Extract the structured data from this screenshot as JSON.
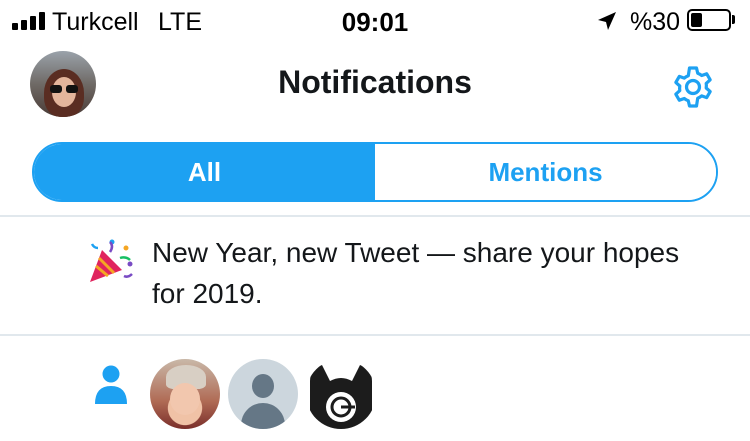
{
  "status_bar": {
    "carrier": "Turkcell",
    "network": "LTE",
    "time": "09:01",
    "battery_text": "%30",
    "battery_level": 0.3
  },
  "header": {
    "title": "Notifications",
    "avatar_icon": "profile-avatar",
    "settings_icon": "gear-icon"
  },
  "tabs": [
    {
      "label": "All",
      "active": true
    },
    {
      "label": "Mentions",
      "active": false
    }
  ],
  "notifications": [
    {
      "type": "promo",
      "icon": "party-popper-icon",
      "text": "New Year, new Tweet — share your hopes for 2019."
    },
    {
      "type": "follow",
      "icon": "person-icon",
      "avatars": [
        "follower-avatar-1",
        "follower-avatar-default",
        "follower-avatar-3"
      ]
    }
  ],
  "colors": {
    "accent": "#1da1f2",
    "text": "#14171a",
    "divider": "#e1e8ed",
    "default_avatar_bg": "#ccd6dd",
    "default_avatar_fg": "#657786"
  }
}
